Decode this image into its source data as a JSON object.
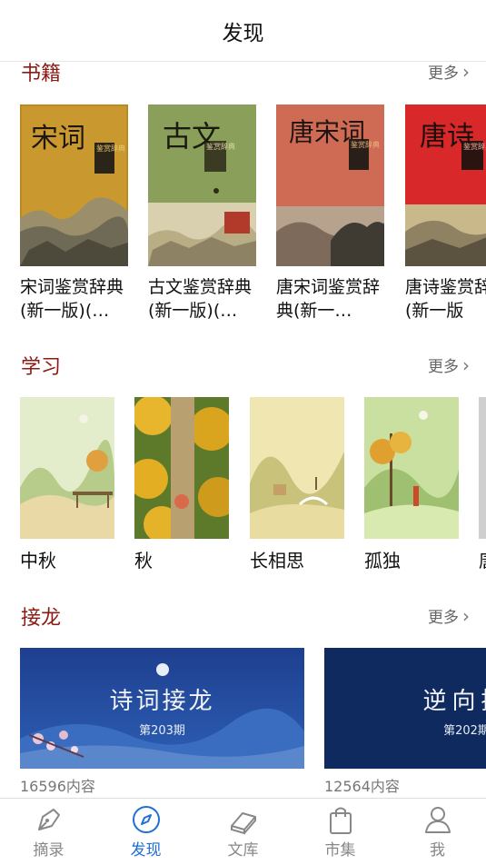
{
  "header": {
    "title": "发现"
  },
  "sections": {
    "books": {
      "title": "书籍",
      "more": "更多",
      "items": [
        {
          "cover_text": "宋词",
          "seal": "鉴赏辞典",
          "title": "宋词鉴赏辞典(新一版)(…"
        },
        {
          "cover_text": "古文",
          "seal": "鉴赏辞典",
          "title": "古文鉴赏辞典(新一版)(…"
        },
        {
          "cover_text": "唐宋词",
          "seal": "鉴赏辞典",
          "title": "唐宋词鉴赏辞典(新一…"
        },
        {
          "cover_text": "唐诗",
          "seal": "鉴赏辞典",
          "title": "唐诗鉴赏辞典(新一版"
        }
      ]
    },
    "study": {
      "title": "学习",
      "more": "更多",
      "items": [
        {
          "title": "中秋"
        },
        {
          "title": "秋"
        },
        {
          "title": "长相思"
        },
        {
          "title": "孤独"
        },
        {
          "title": "唐"
        }
      ]
    },
    "relay": {
      "title": "接龙",
      "more": "更多",
      "items": [
        {
          "banner_title": "诗词接龙",
          "issue": "第203期",
          "count": "16596内容"
        },
        {
          "banner_title": "逆向接",
          "issue": "第202期",
          "count": "12564内容"
        }
      ]
    }
  },
  "tabbar": {
    "items": [
      {
        "label": "摘录",
        "icon": "pen-nib-icon"
      },
      {
        "label": "发现",
        "icon": "compass-icon",
        "active": true
      },
      {
        "label": "文库",
        "icon": "books-icon"
      },
      {
        "label": "市集",
        "icon": "shopping-bag-icon"
      },
      {
        "label": "我",
        "icon": "person-icon"
      }
    ]
  },
  "colors": {
    "accent": "#1f6fd6",
    "section_title": "#8c1c13"
  }
}
